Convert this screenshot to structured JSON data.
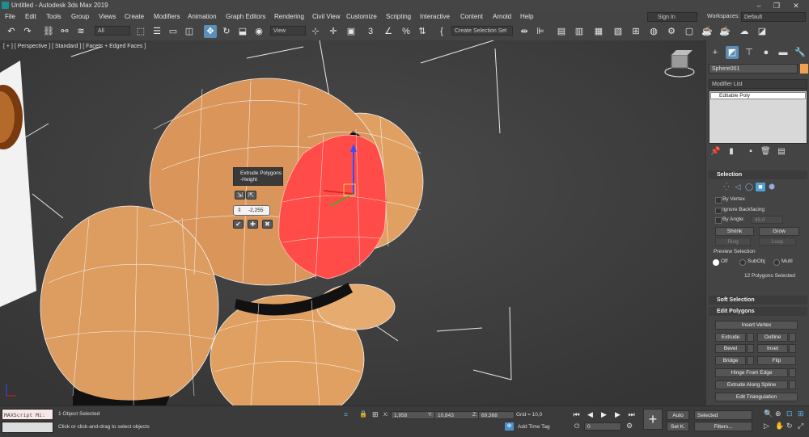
{
  "app": {
    "title": "Untitled - Autodesk 3ds Max 2019"
  },
  "window_controls": [
    "–",
    "❐",
    "✕"
  ],
  "menu": [
    "File",
    "Edit",
    "Tools",
    "Group",
    "Views",
    "Create",
    "Modifiers",
    "Animation",
    "Graph Editors",
    "Rendering",
    "Civil View",
    "Customize",
    "Scripting",
    "Interactive",
    "Content",
    "Arnold",
    "Help"
  ],
  "account": {
    "sign_in": "Sign In",
    "workspaces_label": "Workspaces:",
    "workspace": "Default"
  },
  "toolbar": {
    "filter": "All",
    "ref_coord": "View",
    "selection_set": "Create Selection Set"
  },
  "viewport": {
    "label": "[ + ] [ Perspective ] [ Standard ] [ Facets + Edged Faces ]"
  },
  "caddy": {
    "title": "Extrude Polygons",
    "param": "-Height",
    "value": "-2,255"
  },
  "command_panel": {
    "object_name": "Sphere001",
    "object_color": "#f0a050",
    "modifier_list": "Modifier List",
    "stack_item": "Editable Poly",
    "selection": {
      "title": "Selection",
      "by_vertex": "By Vertex",
      "ignore_backfacing": "Ignore Backfacing",
      "by_angle": "By Angle:",
      "angle_value": "45,0",
      "shrink": "Shrink",
      "grow": "Grow",
      "ring": "Ring",
      "loop": "Loop",
      "preview_title": "Preview Selection",
      "preview_off": "Off",
      "preview_subobj": "SubObj",
      "preview_multi": "Multi",
      "info": "12 Polygons Selected"
    },
    "soft_selection": "Soft Selection",
    "edit_polygons": {
      "title": "Edit Polygons",
      "insert_vertex": "Insert Vertex",
      "extrude": "Extrude",
      "outline": "Outline",
      "bevel": "Bevel",
      "inset": "Inset",
      "bridge": "Bridge",
      "flip": "Flip",
      "hinge": "Hinge From Edge",
      "extrude_spline": "Extrude Along Spline",
      "edit_tri": "Edit Triangulation"
    }
  },
  "status": {
    "maxscript": "MAXScript Mi:",
    "selected": "1 Object Selected",
    "prompt": "Click or click-and-drag to select objects",
    "x_label": "X:",
    "x": "1,958",
    "y_label": "Y:",
    "y": "10,843",
    "z_label": "Z:",
    "z": "69,368",
    "grid": "Grid = 10,0",
    "add_time_tag": "Add Time Tag",
    "frame": "0",
    "auto": "Auto",
    "set_key": "Set K.",
    "key_filter": "Selected",
    "filters": "Filters..."
  }
}
